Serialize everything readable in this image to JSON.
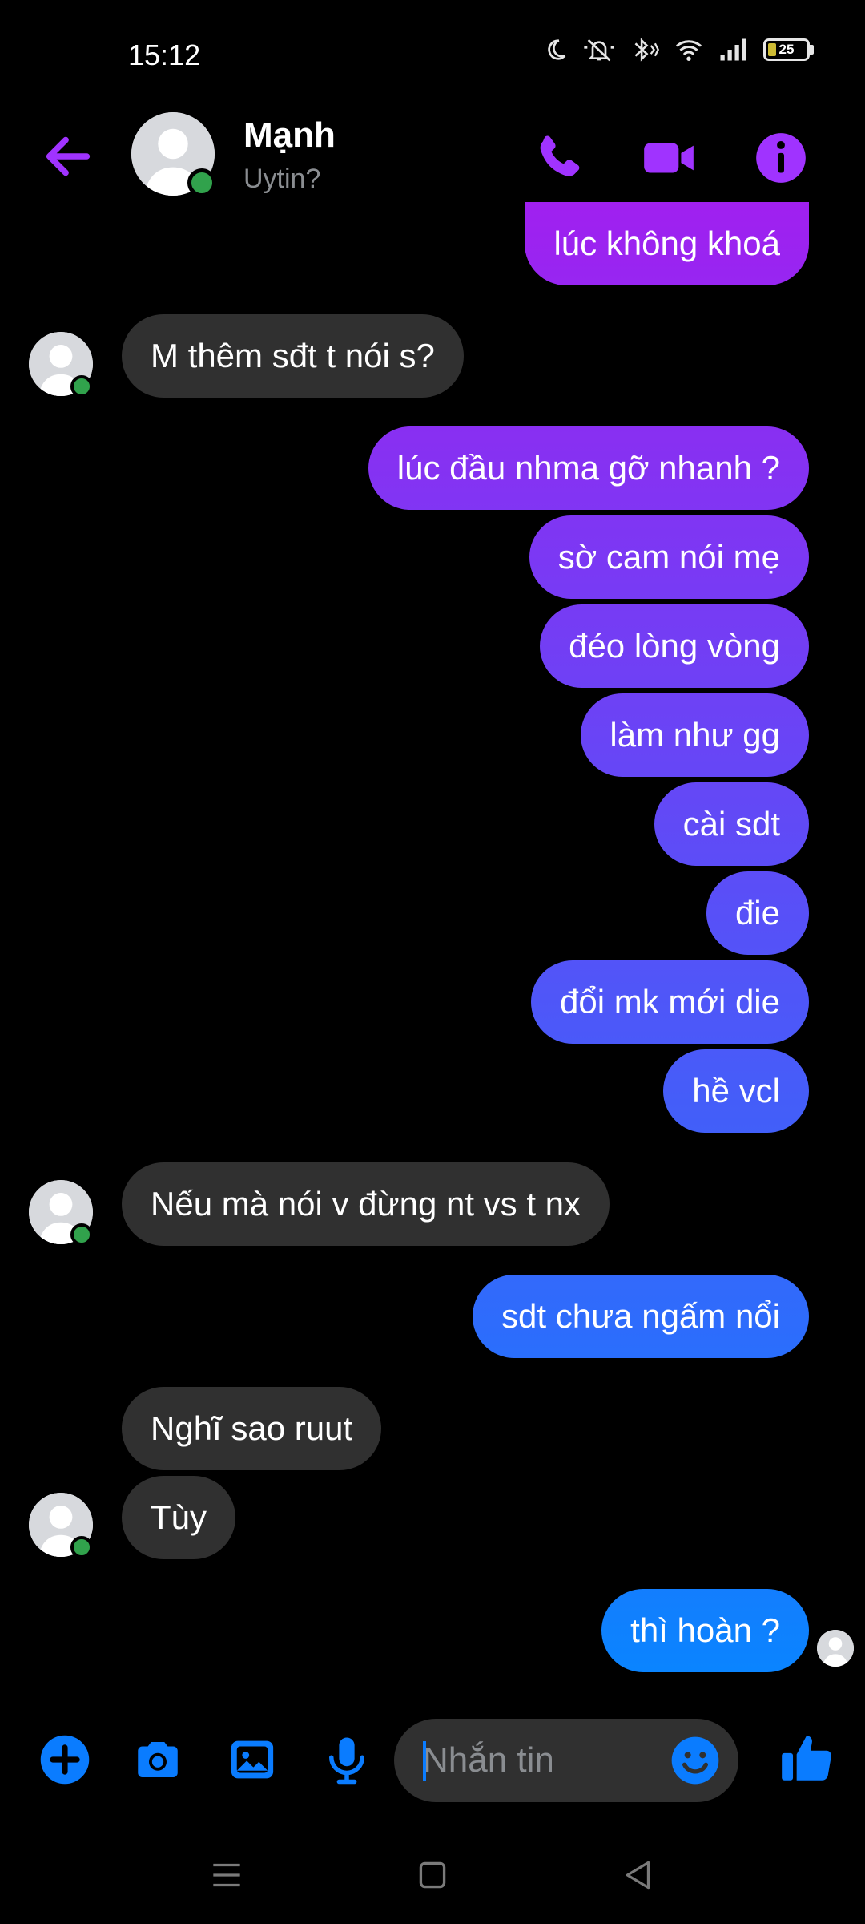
{
  "status_bar": {
    "time": "15:12",
    "battery": "25",
    "icons": [
      "moon-icon",
      "mute-bell-icon",
      "bluetooth-icon",
      "wifi-icon",
      "signal-icon",
      "battery-icon"
    ]
  },
  "header": {
    "contact_name": "Mạnh",
    "contact_status": "Uytin?",
    "online": true
  },
  "messages": [
    {
      "side": "out",
      "text": "lúc không khoá"
    },
    {
      "side": "in",
      "text": "M thêm sđt t nói s?"
    },
    {
      "side": "out",
      "text": "lúc đầu nhma gỡ nhanh ?"
    },
    {
      "side": "out",
      "text": "sờ cam nói mẹ"
    },
    {
      "side": "out",
      "text": "đéo lòng vòng"
    },
    {
      "side": "out",
      "text": "làm như gg"
    },
    {
      "side": "out",
      "text": "cài sdt"
    },
    {
      "side": "out",
      "text": "đie"
    },
    {
      "side": "out",
      "text": "đổi mk mới die"
    },
    {
      "side": "out",
      "text": "hề vcl"
    },
    {
      "side": "in",
      "text": "Nếu mà  nói v đừng nt vs t nx"
    },
    {
      "side": "out",
      "text": "sdt chưa ngấm nổi"
    },
    {
      "side": "in",
      "text": "Nghĩ sao ruut"
    },
    {
      "side": "in",
      "text": "Tùy"
    },
    {
      "side": "out",
      "text": "thì hoàn ?"
    }
  ],
  "composer": {
    "placeholder": "Nhắn tin"
  },
  "colors": {
    "accent": "#a033ff",
    "composer_blue": "#0a7cff",
    "incoming_bubble": "#303030",
    "gradient_top": "#a020f0",
    "gradient_bottom": "#0a84ff"
  }
}
